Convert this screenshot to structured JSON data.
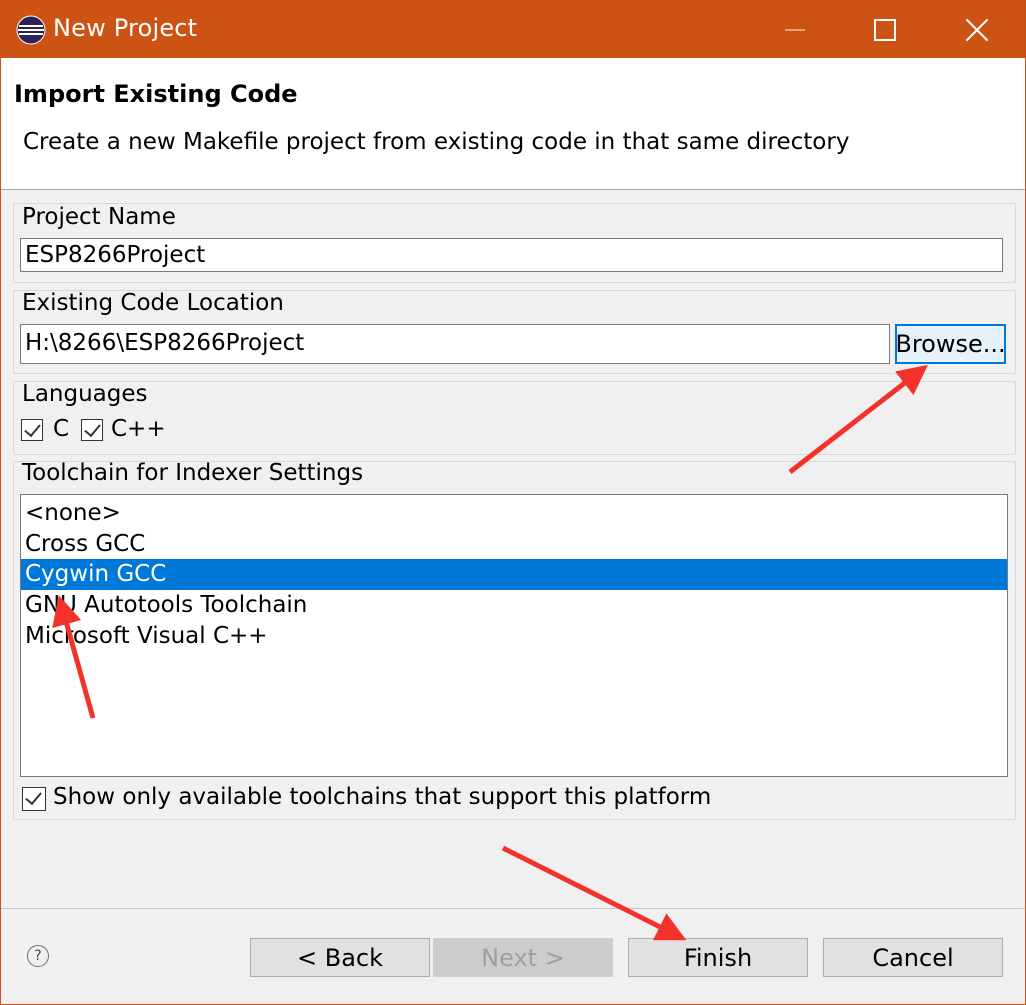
{
  "window": {
    "title": "New Project"
  },
  "header": {
    "heading": "Import Existing Code",
    "description": "Create a new Makefile project from existing code in that same directory"
  },
  "project_name": {
    "label": "Project Name",
    "value": "ESP8266Project"
  },
  "code_location": {
    "label": "Existing Code Location",
    "value": "H:\\8266\\ESP8266Project",
    "browse_label": "Browse..."
  },
  "languages": {
    "label": "Languages",
    "items": [
      {
        "label": "C",
        "checked": true
      },
      {
        "label": "C++",
        "checked": true
      }
    ]
  },
  "toolchain": {
    "label": "Toolchain for Indexer Settings",
    "items": [
      "<none>",
      "Cross GCC",
      "Cygwin GCC",
      "GNU Autotools Toolchain",
      "Microsoft Visual C++"
    ],
    "selected": "Cygwin GCC",
    "filter_label": "Show only available toolchains that support this platform",
    "filter_checked": true
  },
  "footer": {
    "help_glyph": "?",
    "back_label": "< Back",
    "next_label": "Next >",
    "finish_label": "Finish",
    "cancel_label": "Cancel"
  },
  "colors": {
    "titlebar": "#cc5314",
    "selection": "#0078d7",
    "annotation_arrow": "#f2322b"
  }
}
